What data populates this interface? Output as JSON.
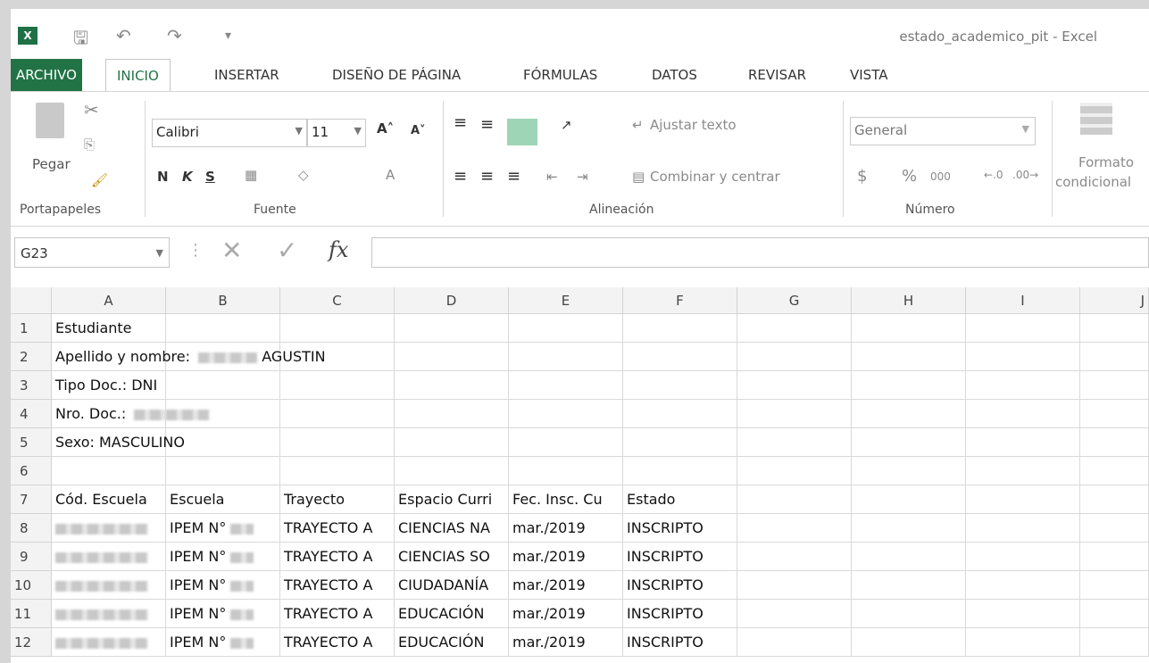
{
  "window": {
    "title": "estado_academico_pit - Excel",
    "app_icon": "excel-icon"
  },
  "tabs": [
    "ARCHIVO",
    "INICIO",
    "INSERTAR",
    "DISEÑO DE PÁGINA",
    "FÓRMULAS",
    "DATOS",
    "REVISAR",
    "VISTA"
  ],
  "ribbon": {
    "clipboard": {
      "paste": "Pegar",
      "group": "Portapapeles"
    },
    "font": {
      "name": "Calibri",
      "size": "11",
      "bold": "N",
      "italic": "K",
      "underline": "S",
      "group": "Fuente"
    },
    "alignment": {
      "wrap": "Ajustar texto",
      "merge": "Combinar y centrar",
      "group": "Alineación"
    },
    "number": {
      "format": "General",
      "currency": "$",
      "percent": "%",
      "thousands": "000",
      "group": "Número"
    },
    "styles": {
      "conditional_line1": "Formato",
      "conditional_line2": "condicional"
    }
  },
  "formula_bar": {
    "name_box": "G23",
    "fx": "fx",
    "value": ""
  },
  "columns": [
    "A",
    "B",
    "C",
    "D",
    "E",
    "F",
    "G",
    "H",
    "I",
    "J"
  ],
  "rows": [
    "1",
    "2",
    "3",
    "4",
    "5",
    "6",
    "7",
    "8",
    "9",
    "10",
    "11",
    "12"
  ],
  "cells": {
    "r1": "Estudiante",
    "r2a": "Apellido y nombre:",
    "r2b": "AGUSTIN",
    "r3": "Tipo Doc.: DNI",
    "r4": "Nro. Doc.:",
    "r5": "Sexo: MASCULINO",
    "headers": [
      "Cód. Escuela",
      "Escuela",
      "Trayecto",
      "Espacio Curri",
      "Fec. Insc. Cu",
      "Estado"
    ],
    "data": [
      {
        "escuela": "IPEM N°",
        "trayecto": "TRAYECTO A",
        "espacio": "CIENCIAS NA",
        "fecha": "mar./2019",
        "estado": "INSCRIPTO"
      },
      {
        "escuela": "IPEM N°",
        "trayecto": "TRAYECTO A",
        "espacio": "CIENCIAS SO",
        "fecha": "mar./2019",
        "estado": "INSCRIPTO"
      },
      {
        "escuela": "IPEM N°",
        "trayecto": "TRAYECTO A",
        "espacio": "CIUDADANÍA",
        "fecha": "mar./2019",
        "estado": "INSCRIPTO"
      },
      {
        "escuela": "IPEM N°",
        "trayecto": "TRAYECTO A",
        "espacio": "EDUCACIÓN",
        "fecha": "mar./2019",
        "estado": "INSCRIPTO"
      },
      {
        "escuela": "IPEM N°",
        "trayecto": "TRAYECTO A",
        "espacio": "EDUCACIÓN",
        "fecha": "mar./2019",
        "estado": "INSCRIPTO"
      }
    ]
  }
}
